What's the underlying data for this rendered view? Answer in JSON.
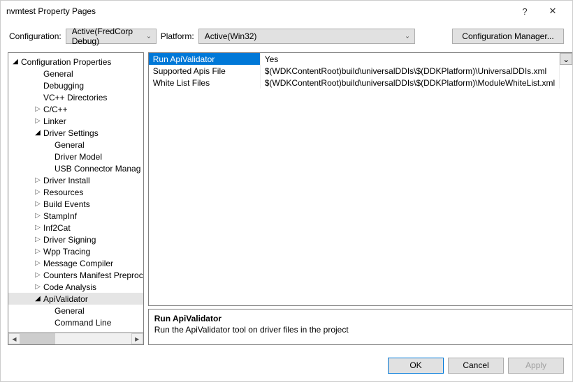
{
  "window": {
    "title": "nvmtest Property Pages"
  },
  "toolbar": {
    "config_label": "Configuration:",
    "config_value": "Active(FredCorp Debug)",
    "platform_label": "Platform:",
    "platform_value": "Active(Win32)",
    "config_mgr_label": "Configuration Manager..."
  },
  "tree": {
    "root": "Configuration Properties",
    "items": [
      {
        "label": "General",
        "depth": 2,
        "exp": ""
      },
      {
        "label": "Debugging",
        "depth": 2,
        "exp": ""
      },
      {
        "label": "VC++ Directories",
        "depth": 2,
        "exp": ""
      },
      {
        "label": "C/C++",
        "depth": 2,
        "exp": "closed"
      },
      {
        "label": "Linker",
        "depth": 2,
        "exp": "closed"
      },
      {
        "label": "Driver Settings",
        "depth": 2,
        "exp": "open"
      },
      {
        "label": "General",
        "depth": 3,
        "exp": ""
      },
      {
        "label": "Driver Model",
        "depth": 3,
        "exp": ""
      },
      {
        "label": "USB Connector Manag",
        "depth": 3,
        "exp": ""
      },
      {
        "label": "Driver Install",
        "depth": 2,
        "exp": "closed"
      },
      {
        "label": "Resources",
        "depth": 2,
        "exp": "closed"
      },
      {
        "label": "Build Events",
        "depth": 2,
        "exp": "closed"
      },
      {
        "label": "StampInf",
        "depth": 2,
        "exp": "closed"
      },
      {
        "label": "Inf2Cat",
        "depth": 2,
        "exp": "closed"
      },
      {
        "label": "Driver Signing",
        "depth": 2,
        "exp": "closed"
      },
      {
        "label": "Wpp Tracing",
        "depth": 2,
        "exp": "closed"
      },
      {
        "label": "Message Compiler",
        "depth": 2,
        "exp": "closed"
      },
      {
        "label": "Counters Manifest Preproc",
        "depth": 2,
        "exp": "closed"
      },
      {
        "label": "Code Analysis",
        "depth": 2,
        "exp": "closed"
      },
      {
        "label": "ApiValidator",
        "depth": 2,
        "exp": "open",
        "selected": true
      },
      {
        "label": "General",
        "depth": 3,
        "exp": ""
      },
      {
        "label": "Command Line",
        "depth": 3,
        "exp": ""
      }
    ]
  },
  "grid": {
    "rows": [
      {
        "name": "Run ApiValidator",
        "value": "Yes",
        "selected": true
      },
      {
        "name": "Supported Apis File",
        "value": "$(WDKContentRoot)build\\universalDDIs\\$(DDKPlatform)\\UniversalDDIs.xml"
      },
      {
        "name": "White List Files",
        "value": "$(WDKContentRoot)build\\universalDDIs\\$(DDKPlatform)\\ModuleWhiteList.xml"
      }
    ]
  },
  "desc": {
    "title": "Run ApiValidator",
    "body": "Run the ApiValidator tool on driver files in the project"
  },
  "footer": {
    "ok": "OK",
    "cancel": "Cancel",
    "apply": "Apply"
  },
  "glyphs": {
    "help": "?",
    "close": "✕",
    "chev_down": "⌄",
    "tri_closed": "▷",
    "tri_open": "◢",
    "tri_left": "◀",
    "tri_right": "▶"
  }
}
